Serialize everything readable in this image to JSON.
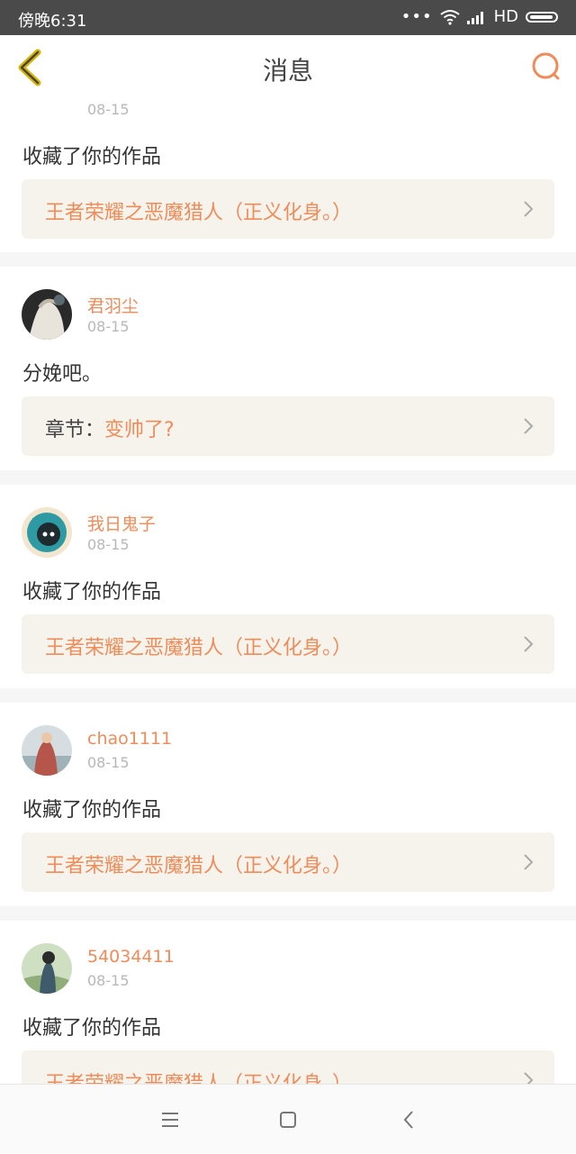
{
  "status_bar": {
    "time": "傍晚6:31",
    "network": "HD"
  },
  "header": {
    "title": "消息"
  },
  "messages": [
    {
      "username": "",
      "date": "08-15",
      "text": "收藏了你的作品",
      "link_prefix": "",
      "link_title": "王者荣耀之恶魔猎人（正义化身。）"
    },
    {
      "username": "君羽尘",
      "date": "08-15",
      "text": "分娩吧。",
      "link_prefix": "章节：",
      "link_title": "变帅了?"
    },
    {
      "username": "我日鬼子",
      "date": "08-15",
      "text": "收藏了你的作品",
      "link_prefix": "",
      "link_title": "王者荣耀之恶魔猎人（正义化身。）"
    },
    {
      "username": "chao1111",
      "date": "08-15",
      "text": "收藏了你的作品",
      "link_prefix": "",
      "link_title": "王者荣耀之恶魔猎人（正义化身。）"
    },
    {
      "username": "54034411",
      "date": "08-15",
      "text": "收藏了你的作品",
      "link_prefix": "",
      "link_title": "王者荣耀之恶魔猎人（正义化身。）"
    }
  ],
  "colors": {
    "accent": "#ee8c5a",
    "back_icon": "#d9b400",
    "link_bg": "#f5f3ec"
  }
}
